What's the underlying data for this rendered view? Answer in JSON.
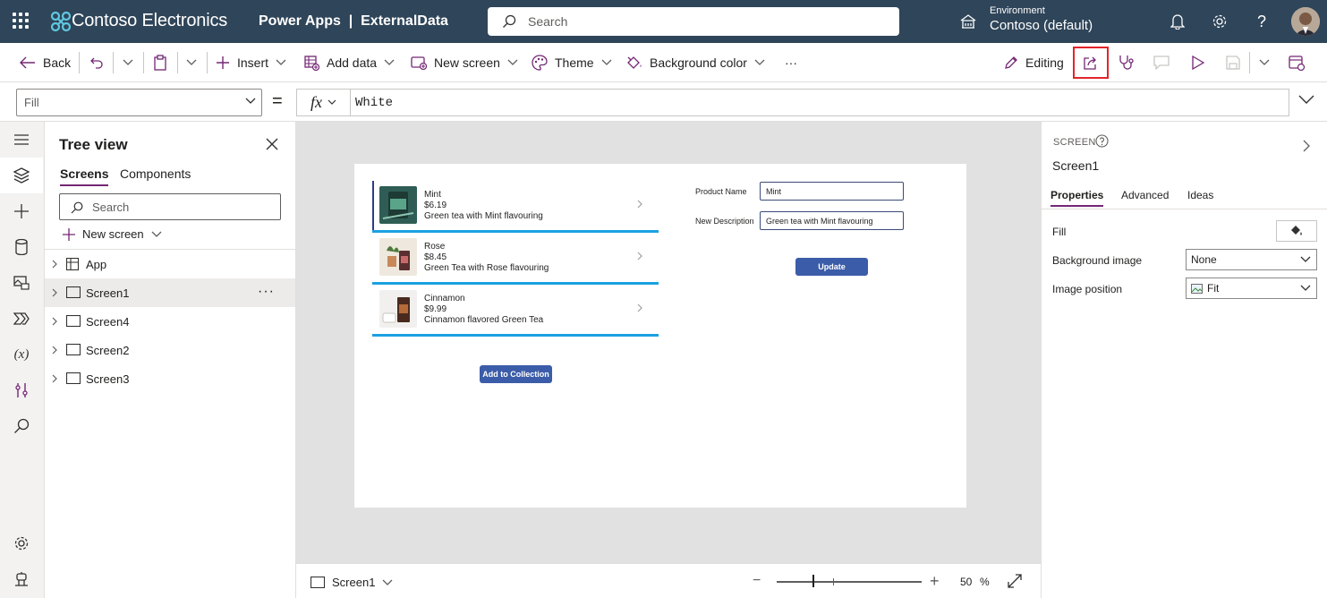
{
  "header": {
    "brand": "Contoso Electronics",
    "app_title": "Power Apps  |  ExternalData",
    "search_placeholder": "Search",
    "environment_label": "Environment",
    "environment_name": "Contoso (default)"
  },
  "commandbar": {
    "back": "Back",
    "insert": "Insert",
    "add_data": "Add data",
    "new_screen": "New screen",
    "theme": "Theme",
    "background_color": "Background color",
    "more": "···",
    "editing": "Editing"
  },
  "formula": {
    "property": "Fill",
    "equals": "=",
    "fx": "fx",
    "value": "White"
  },
  "tree": {
    "title": "Tree view",
    "tabs": [
      "Screens",
      "Components"
    ],
    "search_placeholder": "Search",
    "new_screen": "New screen",
    "nodes": [
      "App",
      "Screen1",
      "Screen4",
      "Screen2",
      "Screen3"
    ],
    "more": "···"
  },
  "canvas": {
    "gallery": [
      {
        "name": "Mint",
        "price": "$6.19",
        "desc": "Green tea with Mint flavouring"
      },
      {
        "name": "Rose",
        "price": "$8.45",
        "desc": "Green Tea with Rose flavouring"
      },
      {
        "name": "Cinnamon",
        "price": "$9.99",
        "desc": "Cinnamon flavored Green Tea"
      }
    ],
    "add_to_collection": "Add to Collection",
    "product_name_label": "Product Name",
    "product_name_value": "Mint",
    "new_description_label": "New Description",
    "new_description_value": "Green tea with Mint flavouring",
    "update": "Update"
  },
  "statusbar": {
    "screen": "Screen1",
    "zoom_minus": "−",
    "zoom_plus": "+",
    "zoom_value": "50",
    "zoom_unit": "%",
    "zoom_level": 0.5
  },
  "properties": {
    "type": "SCREEN",
    "name": "Screen1",
    "tabs": [
      "Properties",
      "Advanced",
      "Ideas"
    ],
    "fill_label": "Fill",
    "background_image_label": "Background image",
    "background_image_value": "None",
    "image_position_label": "Image position",
    "image_position_value": "Fit"
  },
  "colors": {
    "header_bg": "#2f4559",
    "accent": "#742774",
    "highlight_border": "#e3242b",
    "gallery_separator": "#1ba1e2",
    "canvas_button": "#3b5ca8"
  }
}
